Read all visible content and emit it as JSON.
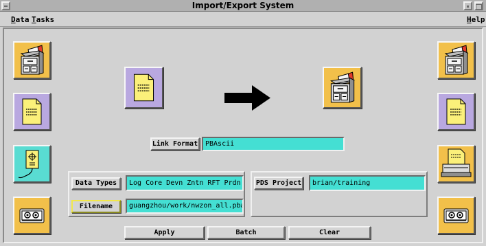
{
  "window": {
    "title": "Import/Export System"
  },
  "menu": {
    "data": "Data",
    "tasks": "Tasks",
    "help": "Help"
  },
  "center": {
    "source_icon": "document-icon",
    "direction_icon": "right-arrow-icon",
    "target_icon": "file-cabinet-icon"
  },
  "link_format": {
    "label": "Link Format",
    "value": "PBAscii"
  },
  "data_types": {
    "label": "Data Types",
    "value": "Log Core Devn Zntn RFT Prdn Au"
  },
  "filename": {
    "label": "Filename",
    "value": "guangzhou/work/nwzon_all.pba"
  },
  "pds_project": {
    "label": "PDS Project",
    "value": "brian/training"
  },
  "actions": {
    "apply": "Apply",
    "batch": "Batch",
    "clear": "Clear"
  },
  "left_toolbar": [
    "file-cabinet-icon",
    "document-icon",
    "tape-connector-icon",
    "tape-reel-icon"
  ],
  "right_toolbar": [
    "file-cabinet-icon",
    "document-icon",
    "printer-icon",
    "tape-reel-icon"
  ],
  "colors": {
    "tile_yellow": "#f2c04a",
    "tile_lavender": "#b9a8e0",
    "tile_cyan": "#59dcd2",
    "field_cyan": "#44dfd3"
  }
}
